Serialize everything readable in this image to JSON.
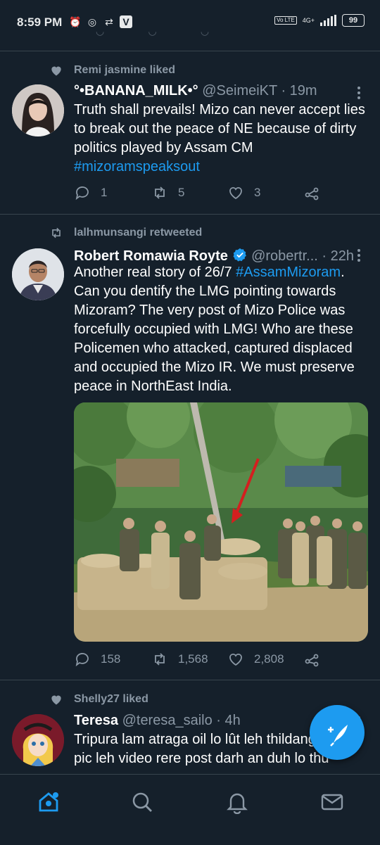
{
  "status_bar": {
    "time": "8:59 PM",
    "network": "4G+",
    "volte": "Vo LTE",
    "battery": "99"
  },
  "tweets": [
    {
      "social_context": "Remi jasmine liked",
      "name": "°•BANANA_MILK•°",
      "handle": "@SeimeiKT",
      "dot": "·",
      "time": "19m",
      "text": "Truth shall prevails! Mizo can never accept lies to break out the peace of NE because of dirty politics played by Assam CM ",
      "hashtag": "#mizoramspeaksout",
      "replies": "1",
      "retweets": "5",
      "likes": "3"
    },
    {
      "social_context": "lalhmunsangi retweeted",
      "name": "Robert Romawia Royte",
      "handle": "@robertr...",
      "dot": "·",
      "time": "22h",
      "text_before": "Another real story of 26/7 ",
      "hashtag": "#AssamMizoram",
      "text_after": ". Can you dentify the LMG pointing towards Mizoram? The very post of Mizo Police was forcefully occupied with LMG! Who are these Policemen who attacked, captured displaced and occupied the Mizo IR. We must preserve peace in NorthEast India.",
      "replies": "158",
      "retweets": "1,568",
      "likes": "2,808"
    },
    {
      "social_context": "Shelly27 liked",
      "name": "Teresa",
      "handle": "@teresa_sailo",
      "dot": "·",
      "time": "4h",
      "text": "Tripura lam atraga oil lo lût leh thildang lanna pic leh video rere post darh an duh lo thu"
    }
  ],
  "bottom_nav": [
    "home-icon",
    "search-icon",
    "notifications-icon",
    "messages-icon"
  ],
  "colors": {
    "background": "#15202b",
    "accent": "#1d9bf0",
    "secondary_text": "#8b98a5",
    "separator": "#38444d"
  }
}
